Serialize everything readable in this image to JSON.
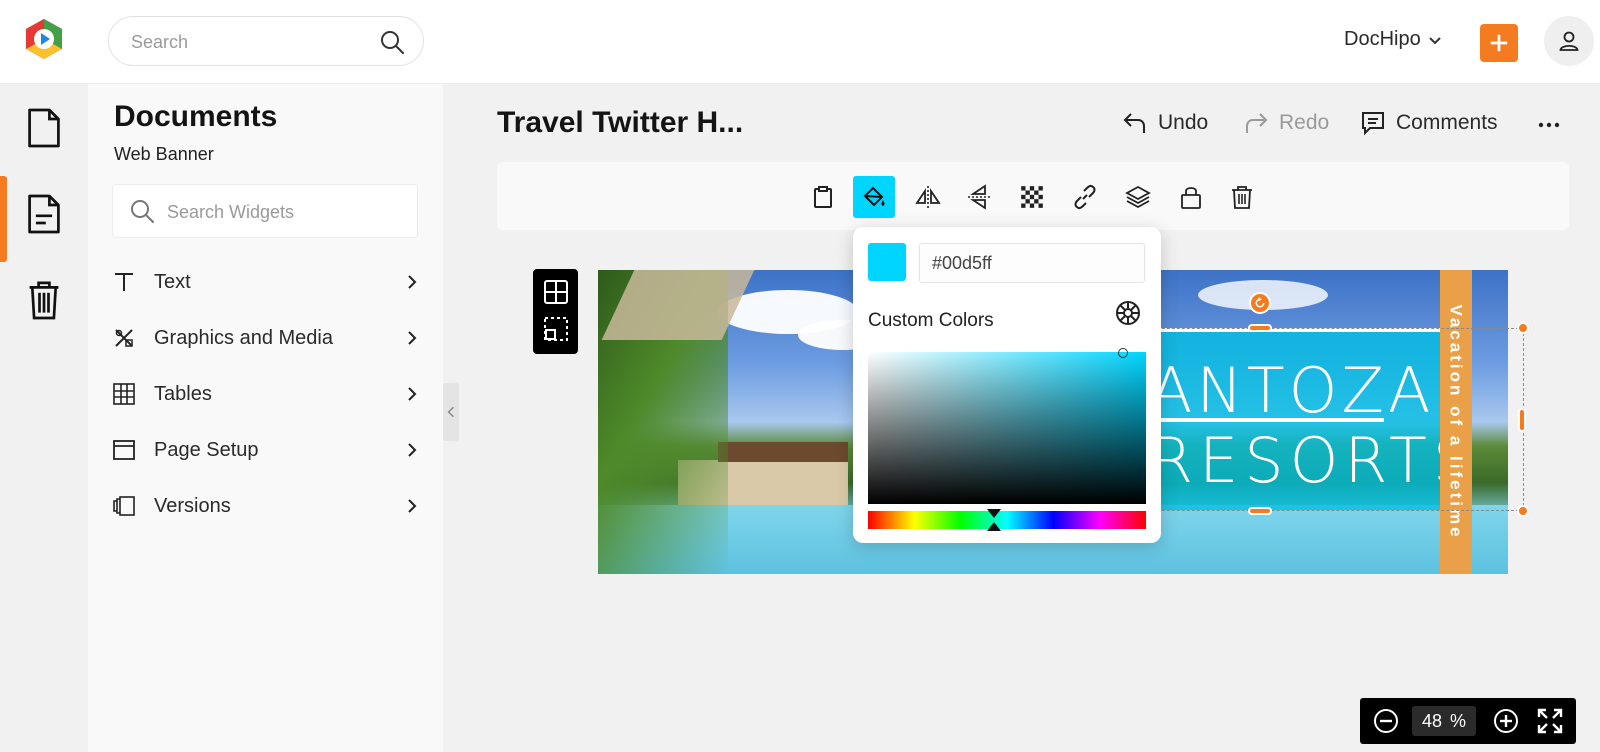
{
  "header": {
    "search_placeholder": "Search",
    "account_name": "DocHipo",
    "accent_color": "#f47b20"
  },
  "rail": {
    "items": [
      {
        "name": "documents",
        "icon": "document-icon",
        "active": false
      },
      {
        "name": "templates",
        "icon": "document-lines-icon",
        "active": true
      },
      {
        "name": "trash",
        "icon": "trash-icon",
        "active": false
      }
    ]
  },
  "panel": {
    "title": "Documents",
    "subtitle": "Web Banner",
    "search_placeholder": "Search Widgets",
    "items": [
      {
        "label": "Text",
        "icon": "text-icon"
      },
      {
        "label": "Graphics and Media",
        "icon": "graphics-icon"
      },
      {
        "label": "Tables",
        "icon": "table-icon"
      },
      {
        "label": "Page Setup",
        "icon": "page-setup-icon"
      },
      {
        "label": "Versions",
        "icon": "versions-icon"
      }
    ]
  },
  "editor": {
    "doc_title": "Travel Twitter H...",
    "undo_label": "Undo",
    "redo_label": "Redo",
    "comments_label": "Comments",
    "toolbar_tools": [
      "clipboard-icon",
      "paint-bucket-icon",
      "flip-horizontal-icon",
      "flip-vertical-icon",
      "transparency-icon",
      "link-icon",
      "layers-icon",
      "lock-icon",
      "trash-icon"
    ],
    "active_tool": "paint-bucket-icon"
  },
  "banner": {
    "brand_line1": "ANTOZA",
    "brand_line2": "RESORTS",
    "vertical_text": "Vacation of a lifetime",
    "strip_color": "#e9a048",
    "overlay_color": "#00bee1"
  },
  "color_picker": {
    "current_hex": "#00d5ff",
    "custom_colors_label": "Custom Colors"
  },
  "zoom": {
    "value": "48",
    "unit": "%"
  }
}
